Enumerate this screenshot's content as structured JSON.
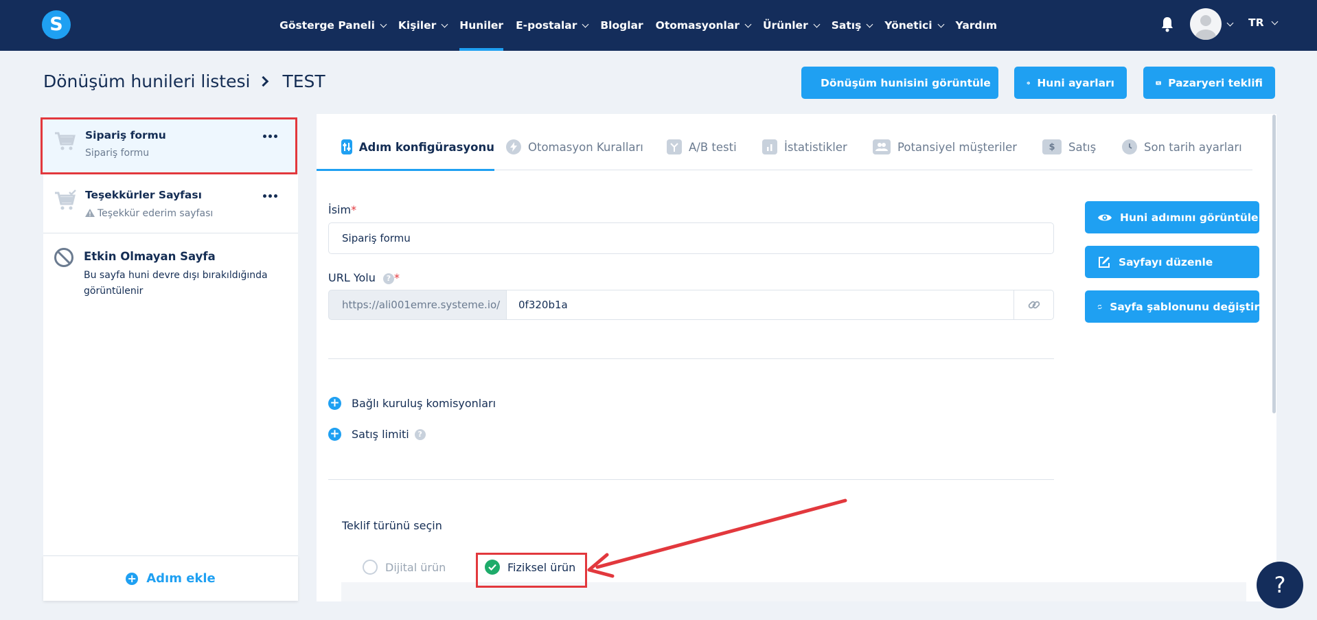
{
  "nav": {
    "logo": "S",
    "items": [
      {
        "label": "Gösterge Paneli",
        "dropdown": true
      },
      {
        "label": "Kişiler",
        "dropdown": true
      },
      {
        "label": "Huniler",
        "dropdown": false,
        "active": true
      },
      {
        "label": "E-postalar",
        "dropdown": true
      },
      {
        "label": "Bloglar",
        "dropdown": false
      },
      {
        "label": "Otomasyonlar",
        "dropdown": true
      },
      {
        "label": "Ürünler",
        "dropdown": true
      },
      {
        "label": "Satış",
        "dropdown": true
      },
      {
        "label": "Yönetici",
        "dropdown": true
      },
      {
        "label": "Yardım",
        "dropdown": false
      }
    ],
    "language": "TR"
  },
  "header": {
    "breadcrumb_parent": "Dönüşüm hunileri listesi",
    "breadcrumb_current": "TEST",
    "buttons": {
      "view_funnel": "Dönüşüm hunisini görüntüle",
      "funnel_settings": "Huni ayarları",
      "marketplace_offer": "Pazaryeri teklifi"
    }
  },
  "steps": [
    {
      "title": "Sipariş formu",
      "subtitle": "Sipariş formu"
    },
    {
      "title": "Teşekkürler Sayfası",
      "subtitle": "Teşekkür ederim sayfası"
    },
    {
      "title": "Etkin Olmayan Sayfa",
      "subtitle": "Bu sayfa huni devre dışı bırakıldığında görüntülenir"
    }
  ],
  "add_step_label": "Adım ekle",
  "tabs": [
    {
      "label": "Adım konfigürasyonu",
      "active": true
    },
    {
      "label": "Otomasyon Kuralları"
    },
    {
      "label": "A/B testi"
    },
    {
      "label": "İstatistikler"
    },
    {
      "label": "Potansiyel müşteriler"
    },
    {
      "label": "Satış"
    },
    {
      "label": "Son tarih ayarları"
    }
  ],
  "form": {
    "name_label": "İsim",
    "name_value": "Sipariş formu",
    "url_label": "URL Yolu",
    "url_prefix": "https://ali001emre.systeme.io/",
    "url_value": "0f320b1a",
    "affiliate_label": "Bağlı kuruluş komisyonları",
    "sales_limit_label": "Satış limiti",
    "offer_type_label": "Teklif türünü seçin",
    "offer_options": [
      {
        "label": "Dijital ürün",
        "selected": false
      },
      {
        "label": "Fiziksel ürün",
        "selected": true
      }
    ]
  },
  "side_buttons": {
    "view_step": "Huni adımını görüntüle",
    "edit_page": "Sayfayı düzenle",
    "change_template": "Sayfa şablonunu değiştir"
  },
  "help_fab": "?",
  "colors": {
    "nav_bg": "#142d5b",
    "accent": "#1fa0f2",
    "highlight": "#e2383d",
    "success": "#1eab6a"
  }
}
